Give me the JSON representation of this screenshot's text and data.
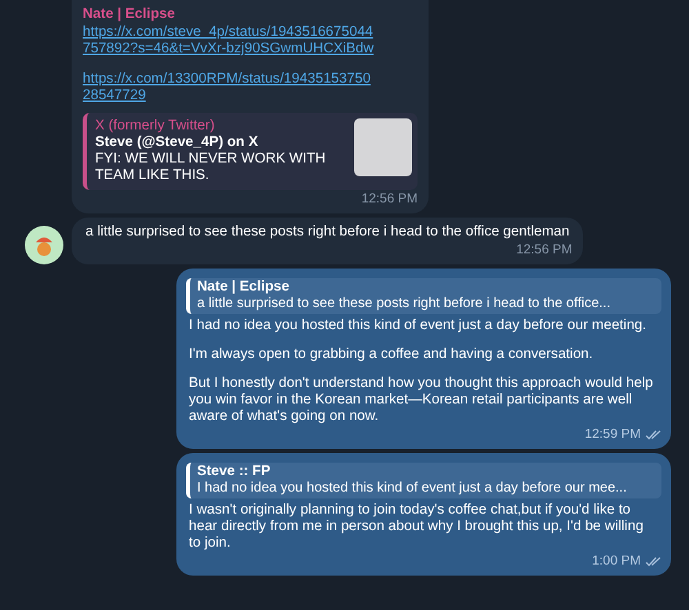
{
  "messages": [
    {
      "kind": "incoming",
      "sender": "Nate | Eclipse",
      "links": [
        "https://x.com/steve_4p/status/1943516675044757892?s=46&t=VvXr-bzj90SGwmUHCXiBdw",
        "https://x.com/13300RPM/status/1943515375028547729"
      ],
      "preview": {
        "site": "X (formerly Twitter)",
        "title": "Steve (@Steve_4P) on X",
        "text": "FYI: WE WILL NEVER WORK WITH TEAM LIKE THIS."
      },
      "time": "12:56 PM"
    },
    {
      "kind": "incoming",
      "paragraphs": [
        "a little surprised to see these posts right before i head to the office gentleman"
      ],
      "time": "12:56 PM"
    },
    {
      "kind": "outgoing",
      "reply": {
        "sender": "Nate | Eclipse",
        "text": "a little surprised to see these posts right before i head to the office..."
      },
      "paragraphs": [
        "I had no idea you hosted this kind of event just a day before our meeting.",
        "I'm always open to grabbing a coffee and having a conversation.",
        "But I honestly don't understand how you thought this approach would help you win favor in the Korean market—Korean retail participants are well aware of what's going on now."
      ],
      "time": "12:59 PM",
      "read": true
    },
    {
      "kind": "outgoing",
      "reply": {
        "sender": "Steve :: FP",
        "text": "I had no idea you hosted this kind of event just a day before our mee..."
      },
      "paragraphs": [
        "I wasn't originally planning to join today's coffee chat,but if you'd like to hear directly from me in person about why I brought this up, I'd be willing to join."
      ],
      "time": "1:00 PM",
      "read": true
    }
  ]
}
